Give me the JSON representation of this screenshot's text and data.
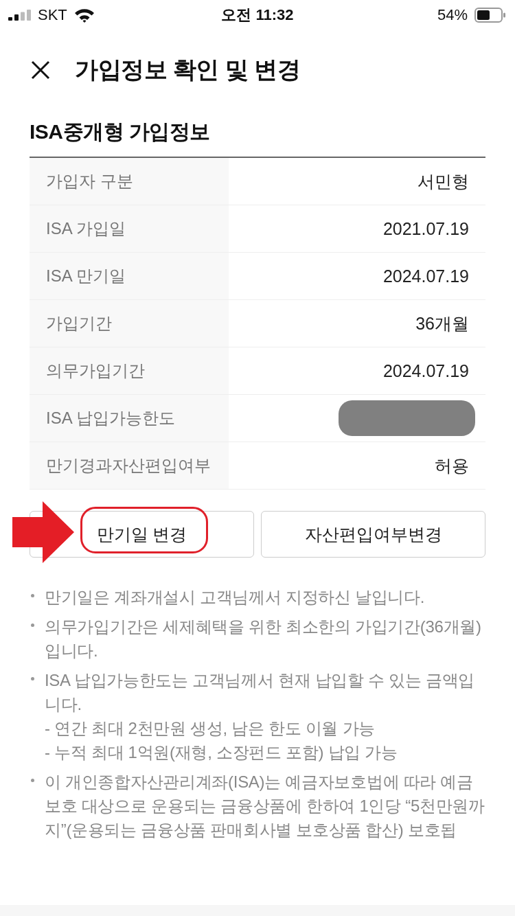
{
  "status_bar": {
    "carrier": "SKT",
    "time": "오전 11:32",
    "battery": "54%"
  },
  "header": {
    "title": "가입정보 확인 및 변경"
  },
  "section": {
    "title": "ISA중개형 가입정보"
  },
  "rows": [
    {
      "label": "가입자 구분",
      "kind": "text",
      "value": "서민형"
    },
    {
      "label": "ISA 가입일",
      "kind": "text",
      "value": "2021.07.19"
    },
    {
      "label": "ISA 만기일",
      "kind": "text",
      "value": "2024.07.19"
    },
    {
      "label": "가입기간",
      "kind": "text",
      "value": "36개월"
    },
    {
      "label": "의무가입기간",
      "kind": "text",
      "value": "2024.07.19"
    },
    {
      "label": "ISA 납입가능한도",
      "kind": "redacted"
    },
    {
      "label": "만기경과자산편입여부",
      "kind": "text",
      "value": "허용"
    }
  ],
  "buttons": [
    {
      "label": "만기일 변경",
      "highlighted": true
    },
    {
      "label": "자산편입여부변경",
      "highlighted": false
    }
  ],
  "notes": [
    {
      "text": "만기일은 계좌개설시 고객님께서 지정하신 날입니다."
    },
    {
      "text": "의무가입기간은 세제혜택을 위한 최소한의 가입기간(36개월)입니다."
    },
    {
      "text": "ISA 납입가능한도는 고객님께서 현재 납입할 수 있는 금액입니다.",
      "sub_items": [
        "- 연간 최대 2천만원 생성, 남은 한도 이월 가능",
        "- 누적 최대 1억원(재형, 소장펀드 포함) 납입 가능"
      ]
    },
    {
      "text": "이 개인종합자산관리계좌(ISA)는 예금자보호법에 따라 예금보호 대상으로 운용되는 금융상품에 한하여 1인당 “5천만원까지”(운용되는 금융상품 판매회사별 보호상품 합산) 보호됩"
    }
  ]
}
